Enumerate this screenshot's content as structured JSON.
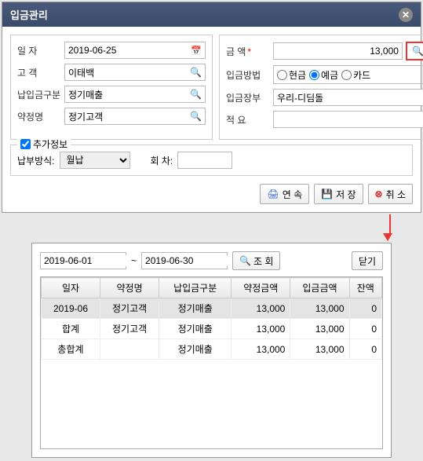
{
  "dialog": {
    "title": "입금관리",
    "left": {
      "date_label": "일 자",
      "date_value": "2019-06-25",
      "customer_label": "고 객",
      "customer_value": "이태백",
      "category_label": "납입금구분",
      "category_value": "정기매출",
      "contract_label": "약정명",
      "contract_value": "정기고객"
    },
    "right": {
      "amount_label": "금 액",
      "amount_value": "13,000",
      "lookup_btn": "조회",
      "method_label": "입금방법",
      "method_options": {
        "cash": "현금",
        "deposit": "예금",
        "card": "카드"
      },
      "account_label": "입금장부",
      "account_value": "우리-디딤돌",
      "memo_label": "적 요",
      "memo_value": ""
    },
    "extra": {
      "legend": "추가정보",
      "paytype_label": "납부방식:",
      "paytype_value": "월납",
      "seq_label": "회 차:",
      "seq_value": ""
    },
    "buttons": {
      "continue": "연 속",
      "save": "저 장",
      "cancel": "취 소"
    }
  },
  "panel2": {
    "date_from": "2019-06-01",
    "date_to": "2019-06-30",
    "tilde": "~",
    "query_btn": "조 회",
    "close_btn": "닫기",
    "headers": [
      "일자",
      "약정명",
      "납입금구분",
      "약정금액",
      "입금금액",
      "잔액"
    ],
    "rows": [
      {
        "c0": "2019-06",
        "c1": "정기고객",
        "c2": "정기매출",
        "c3": "13,000",
        "c4": "13,000",
        "c5": "0",
        "sel": true
      },
      {
        "c0": "합계",
        "c1": "정기고객",
        "c2": "정기매출",
        "c3": "13,000",
        "c4": "13,000",
        "c5": "0"
      },
      {
        "c0": "총합계",
        "c1": "",
        "c2": "정기매출",
        "c3": "13,000",
        "c4": "13,000",
        "c5": "0"
      }
    ]
  }
}
